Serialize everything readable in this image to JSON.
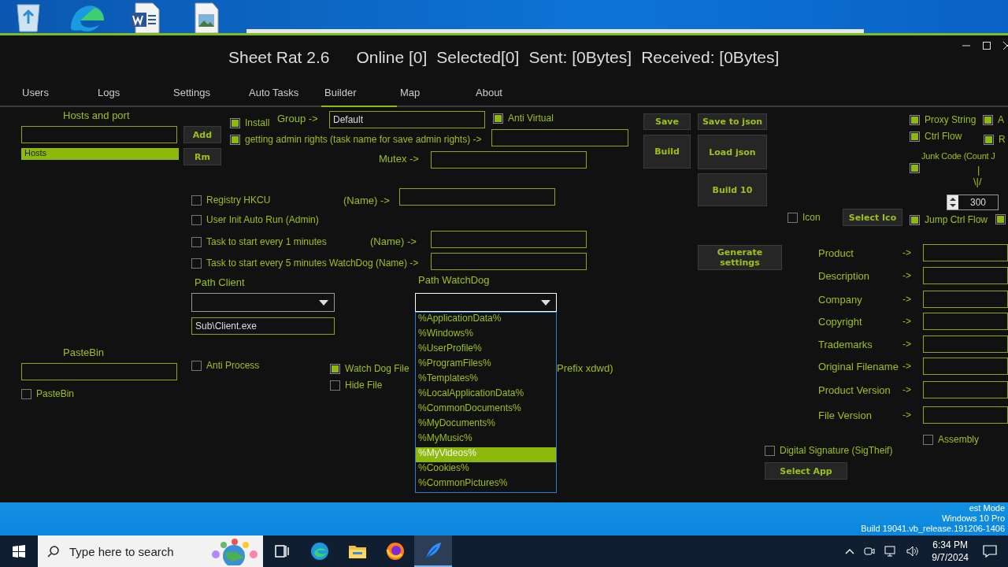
{
  "window": {
    "title": "Sheet Rat 2.6",
    "stats": [
      "Online [0]",
      "Selected[0]",
      "Sent: [0Bytes]",
      "Received: [0Bytes]"
    ]
  },
  "tabs": [
    {
      "label": "Users",
      "selected": false
    },
    {
      "label": "Logs",
      "selected": false
    },
    {
      "label": "Settings",
      "selected": false
    },
    {
      "label": "Auto Tasks",
      "selected": false
    },
    {
      "label": "Builder",
      "selected": true
    },
    {
      "label": "Map",
      "selected": false
    },
    {
      "label": "About",
      "selected": false
    }
  ],
  "builder": {
    "items": [
      {
        "kind": "label",
        "text": "Hosts and port"
      },
      {
        "kind": "field"
      },
      {
        "kind": "button",
        "text": "Add"
      },
      {
        "kind": "list",
        "items": [
          {
            "text": "Hosts",
            "selected": true
          }
        ]
      },
      {
        "kind": "button",
        "text": "Rm"
      },
      {
        "kind": "checkbox",
        "text": "Install",
        "checked": true
      },
      {
        "kind": "label",
        "text": "Group ->"
      },
      {
        "kind": "field",
        "value": "Default"
      },
      {
        "kind": "checkbox",
        "text": "Anti Virtual",
        "checked": true
      },
      {
        "kind": "checkbox",
        "text": "getting admin rights (task name for save admin rights) ->",
        "checked": true
      },
      {
        "kind": "field"
      },
      {
        "kind": "label",
        "text": "Mutex ->"
      },
      {
        "kind": "field"
      },
      {
        "kind": "button",
        "text": "Save"
      },
      {
        "kind": "button",
        "text": "Save to json"
      },
      {
        "kind": "button",
        "text": "Build"
      },
      {
        "kind": "button",
        "text": "Load json"
      },
      {
        "kind": "button",
        "text": "Build 10"
      },
      {
        "kind": "checkbox",
        "text": "Registry HKCU",
        "checked": false
      },
      {
        "kind": "label",
        "text": "(Name) ->"
      },
      {
        "kind": "field"
      },
      {
        "kind": "checkbox",
        "text": "User Init Auto Run (Admin)",
        "checked": false
      },
      {
        "kind": "checkbox",
        "text": "Task to start every 1 minutes",
        "checked": false
      },
      {
        "kind": "label",
        "text": "(Name) ->"
      },
      {
        "kind": "field"
      },
      {
        "kind": "checkbox",
        "text": "Task to start every 5 minutes WatchDog (Name) ->",
        "checked": false
      },
      {
        "kind": "field"
      },
      {
        "kind": "label",
        "text": "Path Client"
      },
      {
        "kind": "combo",
        "expanded": false
      },
      {
        "kind": "field",
        "value": "Sub\\Client.exe"
      },
      {
        "kind": "label",
        "text": "Path WatchDog"
      },
      {
        "kind": "combo",
        "expanded": true,
        "options": [
          {
            "text": "%ApplicationData%",
            "selected": false
          },
          {
            "text": "%Windows%",
            "selected": false
          },
          {
            "text": "%UserProfile%",
            "selected": false
          },
          {
            "text": "%ProgramFiles%",
            "selected": false
          },
          {
            "text": "%Templates%",
            "selected": false
          },
          {
            "text": "%LocalApplicationData%",
            "selected": false
          },
          {
            "text": "%CommonDocuments%",
            "selected": false
          },
          {
            "text": "%MyDocuments%",
            "selected": false
          },
          {
            "text": "%MyMusic%",
            "selected": false
          },
          {
            "text": "%MyVideos%",
            "selected": true
          },
          {
            "text": "%Cookies%",
            "selected": false
          },
          {
            "text": "%CommonPictures%",
            "selected": false
          }
        ]
      },
      {
        "kind": "label",
        "text": "PasteBin"
      },
      {
        "kind": "field"
      },
      {
        "kind": "checkbox",
        "text": "PasteBin",
        "checked": false
      },
      {
        "kind": "checkbox",
        "text": "Anti Process",
        "checked": false
      },
      {
        "kind": "checkbox",
        "text": "Watch Dog File",
        "checked": true
      },
      {
        "kind": "checkbox",
        "text": "Hide File",
        "checked": false
      },
      {
        "kind": "label",
        "text": "Prefix xdwd)"
      },
      {
        "kind": "checkbox",
        "text": "Icon",
        "checked": false
      },
      {
        "kind": "button",
        "text": "Select Ico"
      },
      {
        "kind": "button",
        "text": "Generate settings"
      },
      {
        "kind": "checkbox",
        "text": "Proxy String",
        "checked": true
      },
      {
        "kind": "checkbox",
        "text": "A",
        "checked": true
      },
      {
        "kind": "checkbox",
        "text": "Ctrl Flow",
        "checked": true
      },
      {
        "kind": "checkbox",
        "text": "R",
        "checked": true
      },
      {
        "kind": "checkbox",
        "checked": true
      },
      {
        "kind": "label",
        "text": "Junk Code (Count J"
      },
      {
        "kind": "label",
        "text": "|"
      },
      {
        "kind": "label",
        "text": "\\|/"
      },
      {
        "kind": "spin",
        "value": "300"
      },
      {
        "kind": "checkbox",
        "text": "Jump Ctrl Flow",
        "checked": true
      },
      {
        "kind": "checkbox",
        "checked": true
      },
      {
        "kind": "info",
        "text": "Product",
        "arrow": "->"
      },
      {
        "kind": "info",
        "text": "Description",
        "arrow": "->"
      },
      {
        "kind": "info",
        "text": "Company",
        "arrow": "->"
      },
      {
        "kind": "info",
        "text": "Copyright",
        "arrow": "->"
      },
      {
        "kind": "info",
        "text": "Trademarks",
        "arrow": "->"
      },
      {
        "kind": "info",
        "text": "Original Filename",
        "arrow": "->"
      },
      {
        "kind": "info",
        "text": "Product Version",
        "arrow": "->"
      },
      {
        "kind": "info",
        "text": "File Version",
        "arrow": "->"
      },
      {
        "kind": "checkbox",
        "text": "Assembly",
        "checked": false
      },
      {
        "kind": "checkbox",
        "text": "Digital Signature (SigTheif)",
        "checked": false
      },
      {
        "kind": "button",
        "text": "Select App"
      }
    ]
  },
  "desktop_watermark": [
    "est Mode",
    "Windows 10 Pro",
    "Build 19041.vb_release.191206-1406"
  ],
  "taskbar": {
    "search": {
      "placeholder": "Type here to search"
    },
    "time": "6:34 PM",
    "date": "9/7/2024"
  }
}
